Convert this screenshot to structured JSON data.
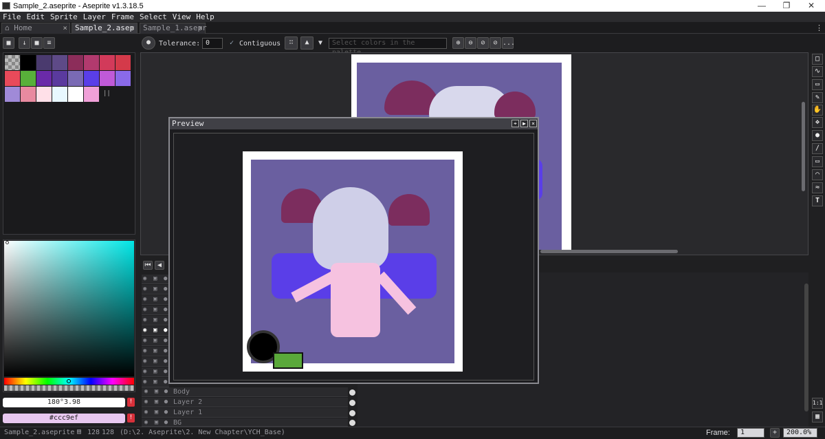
{
  "window": {
    "title": "Sample_2.aseprite - Aseprite v1.3.18.5"
  },
  "menu": [
    "File",
    "Edit",
    "Sprite",
    "Layer",
    "Frame",
    "Select",
    "View",
    "Help"
  ],
  "tabs": [
    {
      "label": "Home"
    },
    {
      "label": "Sample_2.asep"
    },
    {
      "label": "Sample_1.asepr"
    }
  ],
  "toolbar": {
    "tolerance_label": "Tolerance:",
    "tolerance_value": "0",
    "contiguous_label": "Contiguous",
    "contiguous_checked": true,
    "select_colors_placeholder": "Select colors in the palette",
    "more_label": "..."
  },
  "palette": {
    "colors": [
      "#ffffff",
      "#000000",
      "#4a3a6e",
      "#5e4a87",
      "#8c2d5a",
      "#b23a6e",
      "#d23a5a",
      "#d43a4a",
      "#e84a5a",
      "#58b03a",
      "#6a2aa8",
      "#5a3a9e",
      "#7a6ab4",
      "#5a3ee8",
      "#c05ad8",
      "#8a6ae8",
      "#a08ad8",
      "#e88aa0",
      "#ffe0e8",
      "#e8f8ff",
      "#ffffff",
      "#f0a0d8"
    ]
  },
  "color_picker": {
    "foreground_value": "180°3.98",
    "background_value": "#ccc9ef",
    "foreground_color": "#ffffff",
    "background_color": "#e8c8f0"
  },
  "preview": {
    "title": "Preview"
  },
  "layers": [
    {
      "name": "Body"
    },
    {
      "name": "Layer 2"
    },
    {
      "name": "Layer 1"
    },
    {
      "name": "BG"
    }
  ],
  "status": {
    "filename": "Sample_2.aseprite",
    "size_w": "128",
    "size_h": "128",
    "path": "(D:\\2. Aseprite\\2. New Chapter\\YCH_Base)",
    "frame_label": "Frame:",
    "frame_value": "1",
    "zoom": "200.0%"
  },
  "icons": [
    "app-icon",
    "minimize-icon",
    "maximize-icon",
    "close-icon",
    "home-icon",
    "lock-icon",
    "eye-icon",
    "bucket-icon"
  ]
}
